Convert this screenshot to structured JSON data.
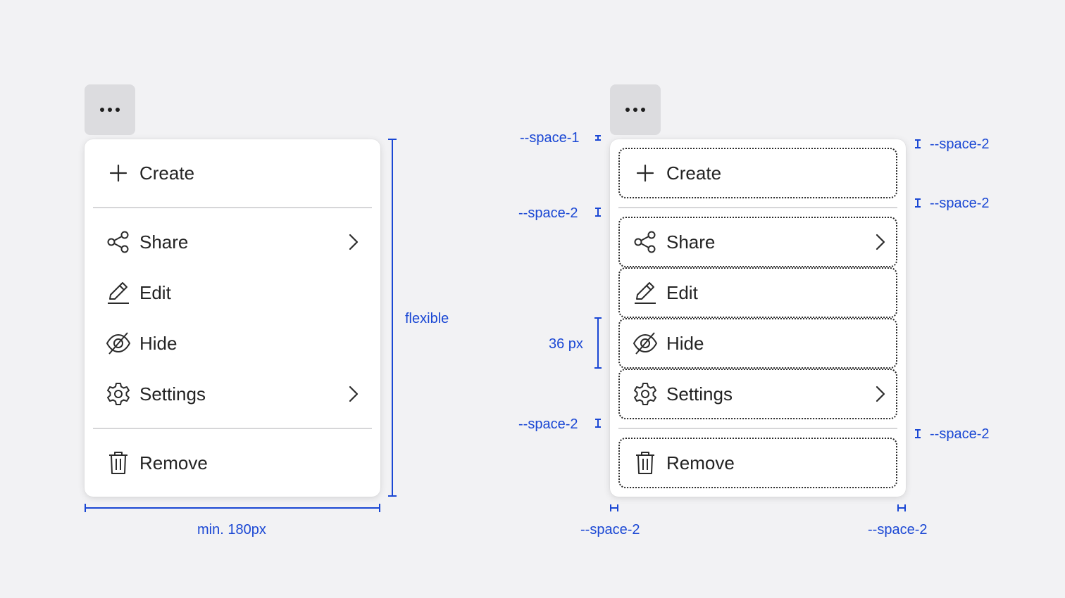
{
  "menu_items": {
    "create": "Create",
    "share": "Share",
    "edit": "Edit",
    "hide": "Hide",
    "settings": "Settings",
    "remove": "Remove"
  },
  "annotations": {
    "min_width": "min. 180px",
    "flexible": "flexible",
    "item_height": "36 px",
    "space_1": "--space-1",
    "space_2": "--space-2"
  },
  "colors": {
    "annotation": "#1a47d4",
    "background": "#f2f2f4",
    "trigger": "#dcdcdf"
  },
  "icons": [
    "more-dots-icon",
    "plus-icon",
    "share-icon",
    "pencil-icon",
    "eye-off-icon",
    "gear-icon",
    "trash-icon",
    "chevron-right-icon"
  ]
}
